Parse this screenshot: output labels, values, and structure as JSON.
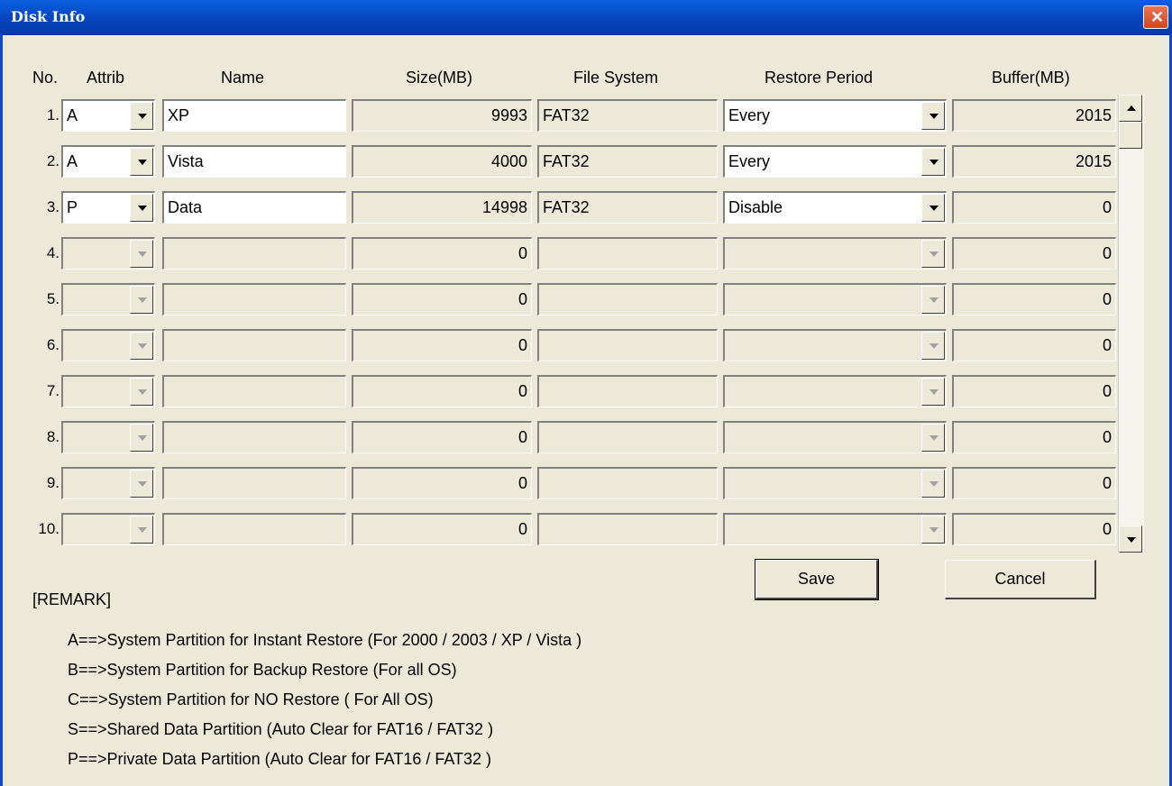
{
  "window": {
    "title": "Disk Info",
    "close_symbol": "✕"
  },
  "headers": {
    "no": "No.",
    "attrib": "Attrib",
    "name": "Name",
    "size": "Size(MB)",
    "fs": "File System",
    "restore": "Restore Period",
    "buffer": "Buffer(MB)"
  },
  "rows": [
    {
      "no": "1.",
      "attrib": "A",
      "name": "XP",
      "size": "9993",
      "fs": "FAT32",
      "restore": "Every",
      "buffer": "2015",
      "enabled": true
    },
    {
      "no": "2.",
      "attrib": "A",
      "name": "Vista",
      "size": "4000",
      "fs": "FAT32",
      "restore": "Every",
      "buffer": "2015",
      "enabled": true
    },
    {
      "no": "3.",
      "attrib": "P",
      "name": "Data",
      "size": "14998",
      "fs": "FAT32",
      "restore": "Disable",
      "buffer": "0",
      "enabled": true
    },
    {
      "no": "4.",
      "attrib": "",
      "name": "",
      "size": "0",
      "fs": "",
      "restore": "",
      "buffer": "0",
      "enabled": false
    },
    {
      "no": "5.",
      "attrib": "",
      "name": "",
      "size": "0",
      "fs": "",
      "restore": "",
      "buffer": "0",
      "enabled": false
    },
    {
      "no": "6.",
      "attrib": "",
      "name": "",
      "size": "0",
      "fs": "",
      "restore": "",
      "buffer": "0",
      "enabled": false
    },
    {
      "no": "7.",
      "attrib": "",
      "name": "",
      "size": "0",
      "fs": "",
      "restore": "",
      "buffer": "0",
      "enabled": false
    },
    {
      "no": "8.",
      "attrib": "",
      "name": "",
      "size": "0",
      "fs": "",
      "restore": "",
      "buffer": "0",
      "enabled": false
    },
    {
      "no": "9.",
      "attrib": "",
      "name": "",
      "size": "0",
      "fs": "",
      "restore": "",
      "buffer": "0",
      "enabled": false
    },
    {
      "no": "10.",
      "attrib": "",
      "name": "",
      "size": "0",
      "fs": "",
      "restore": "",
      "buffer": "0",
      "enabled": false
    }
  ],
  "buttons": {
    "save": "Save",
    "cancel": "Cancel"
  },
  "remark": {
    "title": "[REMARK]",
    "lines": [
      "A==>System Partition for Instant Restore (For  2000 / 2003 / XP / Vista )",
      "B==>System Partition for Backup Restore (For all OS)",
      "C==>System Partition for NO Restore ( For All OS)",
      "S==>Shared Data Partition (Auto Clear for FAT16 / FAT32 )",
      "P==>Private Data Partition (Auto Clear for FAT16 / FAT32 )"
    ]
  }
}
